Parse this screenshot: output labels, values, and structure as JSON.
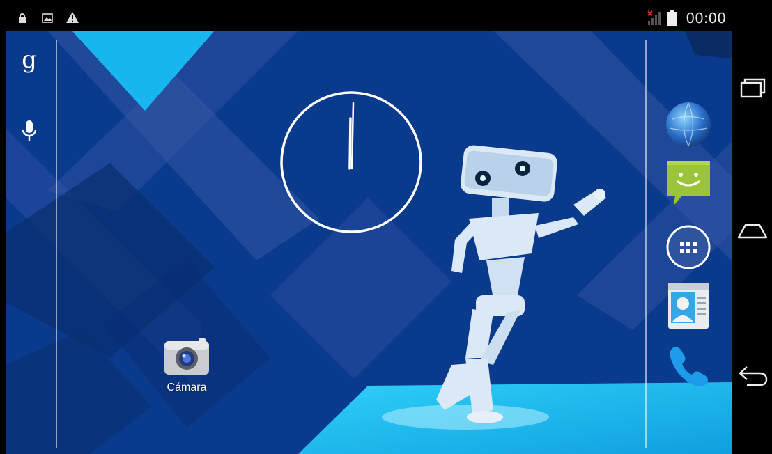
{
  "status_bar": {
    "time": "00:00",
    "left_icons": [
      "lock-icon",
      "image-icon",
      "warning-icon"
    ],
    "right_icons": [
      "signal-no-sim-icon",
      "battery-icon"
    ]
  },
  "left_bar": {
    "icons": [
      "google-search-icon",
      "microphone-icon"
    ],
    "google_glyph": "g"
  },
  "clock_widget": {
    "type": "analog-clock"
  },
  "desktop": {
    "shortcuts": [
      {
        "label": "Cámara",
        "icon": "camera-icon"
      }
    ]
  },
  "dock": {
    "items": [
      "browser-globe-icon",
      "messaging-icon",
      "app-drawer-icon",
      "contacts-icon",
      "phone-icon"
    ]
  },
  "nav_bar": {
    "buttons": [
      "recent-apps-icon",
      "home-icon",
      "back-icon"
    ]
  },
  "colors": {
    "wallpaper_base": "#0a3a8c",
    "accent_cyan": "#1ec0f0",
    "icon_green": "#9bc43a"
  }
}
